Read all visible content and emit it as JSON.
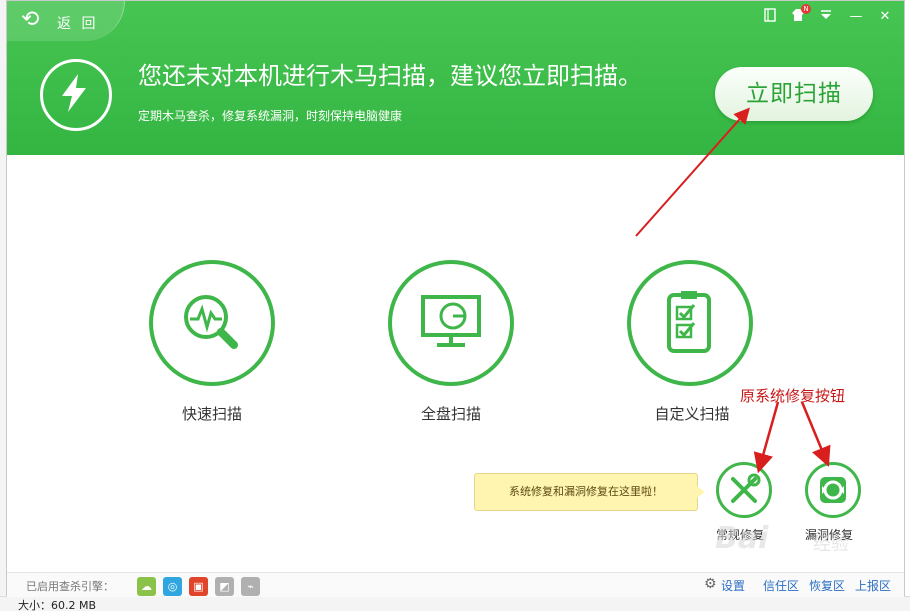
{
  "window": {
    "back_label": "返 回",
    "controls": {
      "skin_icon": "skin-icon",
      "tshirt_icon": "tshirt-icon",
      "badge": "N",
      "menu_icon": "menu-icon",
      "minimize": "—",
      "close": "✕"
    }
  },
  "header": {
    "headline": "您还未对本机进行木马扫描，建议您立即扫描。",
    "subline": "定期木马查杀，修复系统漏洞，时刻保持电脑健康",
    "scan_now": "立即扫描",
    "bolt_icon": "lightning-icon"
  },
  "scan_options": [
    {
      "label": "快速扫描",
      "icon": "magnifier-pulse-icon"
    },
    {
      "label": "全盘扫描",
      "icon": "monitor-icon"
    },
    {
      "label": "自定义扫描",
      "icon": "checklist-icon"
    }
  ],
  "repair": {
    "tip": "系统修复和漏洞修复在这里啦！",
    "annotation": "原系统修复按钮",
    "items": [
      {
        "label": "常规修复",
        "icon": "wrench-screwdriver-icon"
      },
      {
        "label": "漏洞修复",
        "icon": "shield-repair-icon"
      }
    ]
  },
  "footer": {
    "engines_label": "已启用查杀引擎：",
    "engines": [
      {
        "icon": "cloud-engine-icon",
        "color": "#8bc34a"
      },
      {
        "icon": "qvm-engine-icon",
        "color": "#2fa6e0"
      },
      {
        "icon": "bitdefender-engine-icon",
        "color": "#e0452c"
      },
      {
        "icon": "local-engine-icon",
        "color": "#b0b0b0"
      },
      {
        "icon": "system-engine-icon",
        "color": "#b0b0b0"
      }
    ],
    "links": {
      "settings": "设置",
      "trust": "信任区",
      "restore": "恢复区",
      "report": "上报区"
    }
  },
  "background": {
    "size_text": "大小：60.2 MB"
  },
  "watermark": {
    "text": "Bai",
    "sub": "经验"
  },
  "colors": {
    "brand_green": "#3cba4a",
    "annotation_red": "#d91e1e",
    "link_blue": "#2b6fc2"
  }
}
